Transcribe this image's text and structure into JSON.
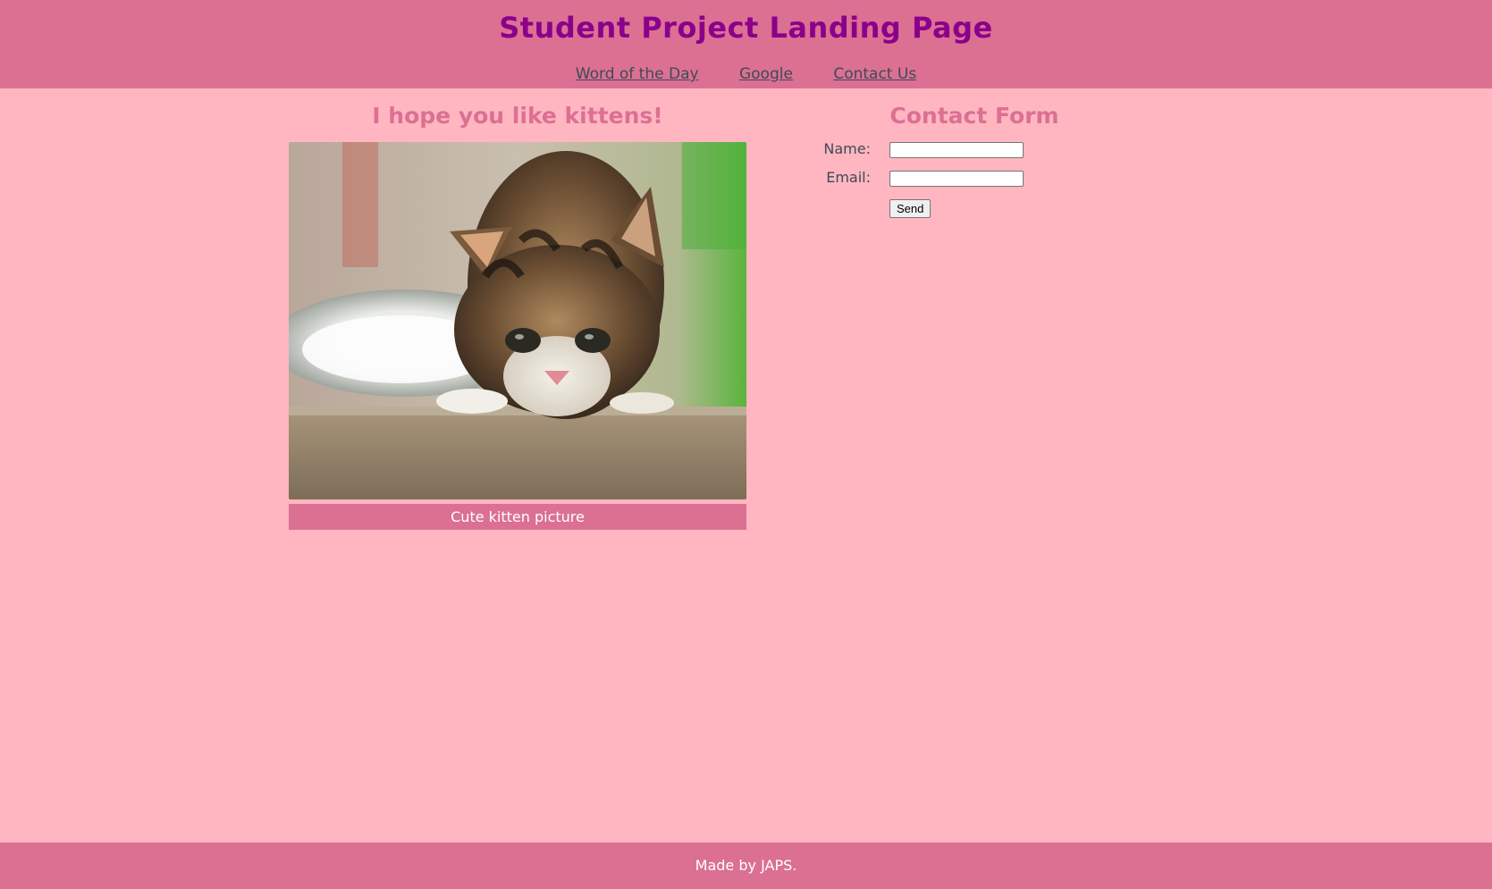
{
  "header": {
    "title": "Student Project Landing Page",
    "nav": [
      {
        "label": "Word of the Day"
      },
      {
        "label": "Google"
      },
      {
        "label": "Contact Us"
      }
    ]
  },
  "kittens": {
    "heading": "I hope you like kittens!",
    "caption": "Cute kitten picture"
  },
  "contact": {
    "heading": "Contact Form",
    "name_label": "Name:",
    "name_value": "",
    "email_label": "Email:",
    "email_value": "",
    "send_label": "Send"
  },
  "footer": {
    "text": "Made by JAPS."
  },
  "colors": {
    "background": "#ffb6c1",
    "bar": "#db7093",
    "title": "#8b008b",
    "heading": "#db7093"
  }
}
